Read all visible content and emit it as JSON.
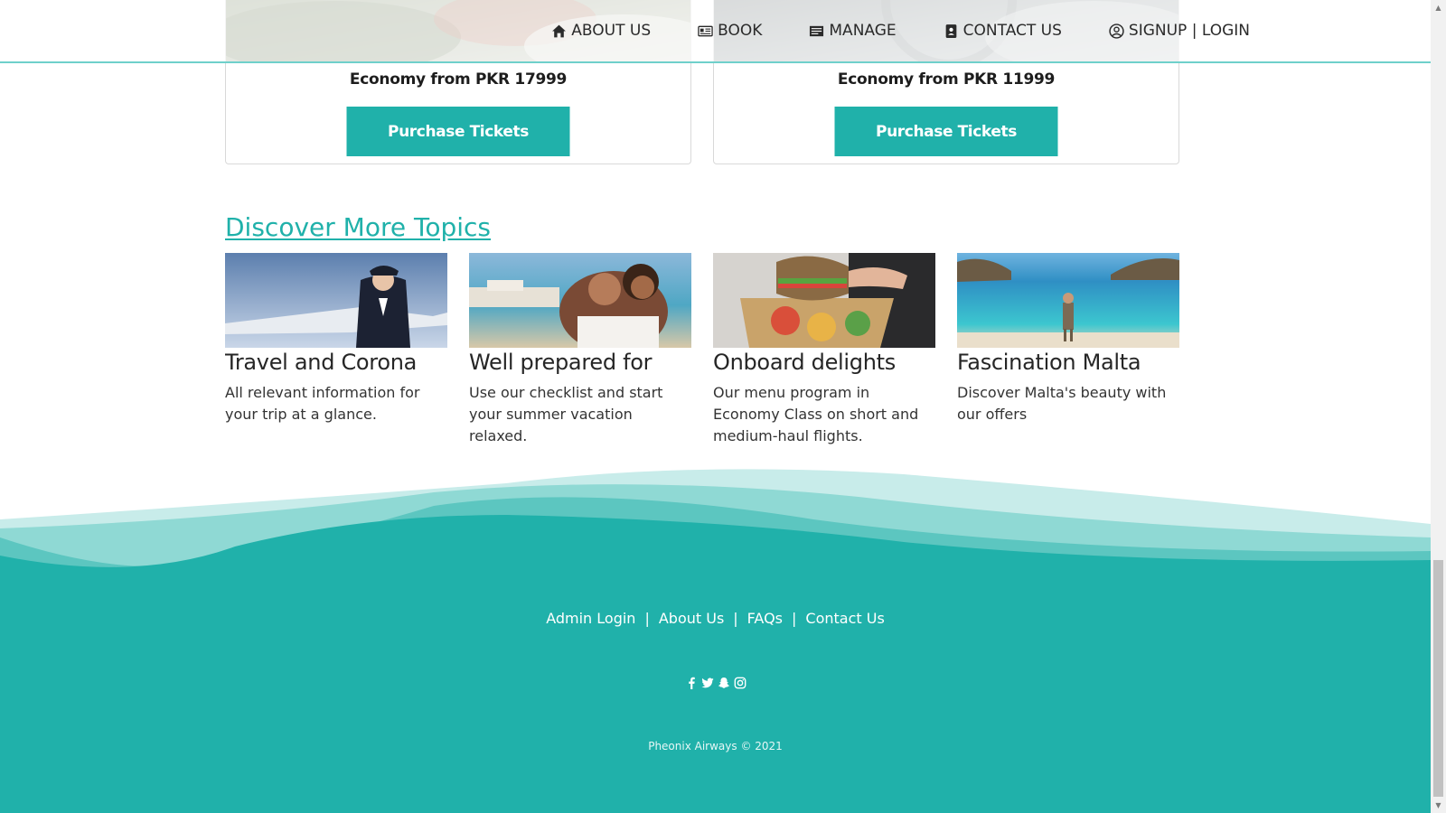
{
  "nav": {
    "about": "ABOUT US",
    "book": "BOOK",
    "manage": "MANAGE",
    "contact": "CONTACT US",
    "signup": "SIGNUP | LOGIN"
  },
  "cards": [
    {
      "fare": "Economy from PKR 17999",
      "button": "Purchase Tickets"
    },
    {
      "fare": "Economy from PKR 11999",
      "button": "Purchase Tickets"
    }
  ],
  "discover": {
    "title": "Discover More Topics",
    "topics": [
      {
        "title": "Travel and Corona",
        "text": "All relevant information for your trip at a glance."
      },
      {
        "title": "Well prepared for",
        "text": "Use our checklist and start your summer vacation relaxed."
      },
      {
        "title": "Onboard delights",
        "text": "Our menu program in Economy Class on short and medium-haul flights."
      },
      {
        "title": "Fascination Malta",
        "text": "Discover Malta's beauty with our offers"
      }
    ]
  },
  "footer": {
    "links": [
      "Admin Login",
      "About Us",
      "FAQs",
      "Contact Us"
    ],
    "social": [
      "facebook-icon",
      "twitter-icon",
      "snapchat-icon",
      "instagram-icon"
    ],
    "copyright": "Pheonix Airways © 2021"
  },
  "colors": {
    "accent": "#20b1aa",
    "nav_border": "#6fd0cb"
  }
}
